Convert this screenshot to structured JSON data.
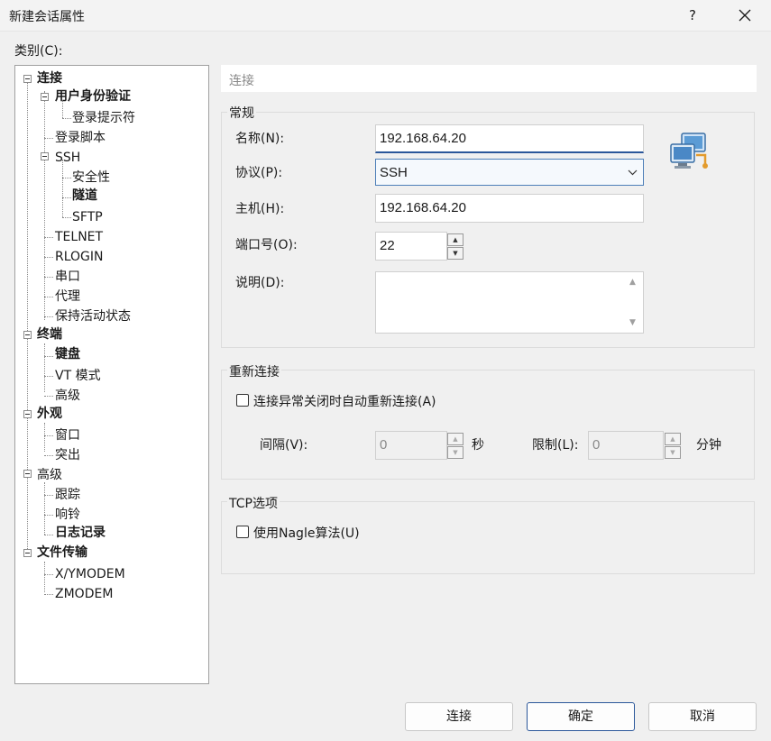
{
  "window": {
    "title": "新建会话属性",
    "help": "?"
  },
  "category_label": "类别(C):",
  "tree": {
    "connection": "连接",
    "user_auth": "用户身份验证",
    "login_prompt": "登录提示符",
    "login_script": "登录脚本",
    "ssh": "SSH",
    "security": "安全性",
    "tunnel": "隧道",
    "sftp": "SFTP",
    "telnet": "TELNET",
    "rlogin": "RLOGIN",
    "serial": "串口",
    "proxy": "代理",
    "keepalive": "保持活动状态",
    "terminal": "终端",
    "keyboard": "键盘",
    "vt_mode": "VT 模式",
    "advanced_term": "高级",
    "appearance": "外观",
    "window_item": "窗口",
    "highlight": "突出",
    "advanced": "高级",
    "trace": "跟踪",
    "bell": "响铃",
    "logging": "日志记录",
    "file_transfer": "文件传输",
    "xymodem": "X/YMODEM",
    "zmodem": "ZMODEM"
  },
  "header": "连接",
  "general": {
    "legend": "常规",
    "name_label": "名称(N):",
    "name_value": "192.168.64.20",
    "protocol_label": "协议(P):",
    "protocol_value": "SSH",
    "host_label": "主机(H):",
    "host_value": "192.168.64.20",
    "port_label": "端口号(O):",
    "port_value": "22",
    "desc_label": "说明(D):",
    "desc_value": ""
  },
  "reconnect": {
    "legend": "重新连接",
    "auto_label": "连接异常关闭时自动重新连接(A)",
    "auto_checked": false,
    "interval_label": "间隔(V):",
    "interval_value": "0",
    "seconds_unit": "秒",
    "limit_label": "限制(L):",
    "limit_value": "0",
    "minutes_unit": "分钟"
  },
  "tcp": {
    "legend": "TCP选项",
    "nagle_label": "使用Nagle算法(U)",
    "nagle_checked": false
  },
  "buttons": {
    "connect": "连接",
    "ok": "确定",
    "cancel": "取消"
  },
  "icons": {
    "network": "network-computers-icon"
  },
  "colors": {
    "accent": "#2b579a"
  }
}
